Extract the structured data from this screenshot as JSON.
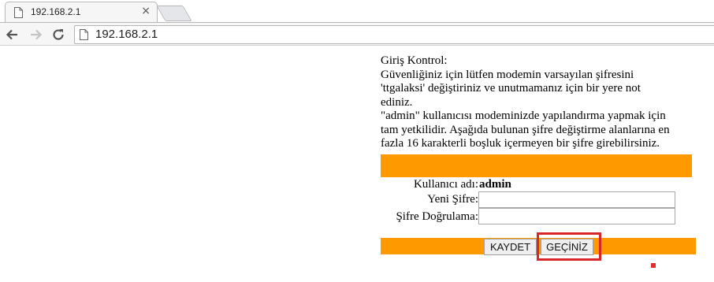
{
  "browser": {
    "tab_title": "192.168.2.1",
    "tab_close": "×",
    "url": "192.168.2.1"
  },
  "intro_lines": [
    "Giriş Kontrol:",
    "Güvenliğiniz için lütfen modemin varsayılan şifresini",
    "'ttgalaksi' değiştiriniz ve unutmamanız için bir yere not",
    "ediniz.",
    "\"admin\" kullanıcısı modeminizde yapılandırma yapmak için",
    "tam yetkilidir. Aşağıda bulunan şifre değiştirme alanlarına en",
    "fazla 16 karakterli boşluk içermeyen bir şifre girebilirsiniz."
  ],
  "form": {
    "username_label": "Kullanıcı adı:",
    "username_value": "admin",
    "new_password_label": "Yeni Şifre:",
    "new_password_value": "",
    "confirm_label": "Şifre Doğrulama:",
    "confirm_value": ""
  },
  "buttons": {
    "save": "KAYDET",
    "skip": "GEÇİNİZ"
  },
  "colors": {
    "accent_bar": "#ff9900",
    "highlight": "#d9262b"
  }
}
